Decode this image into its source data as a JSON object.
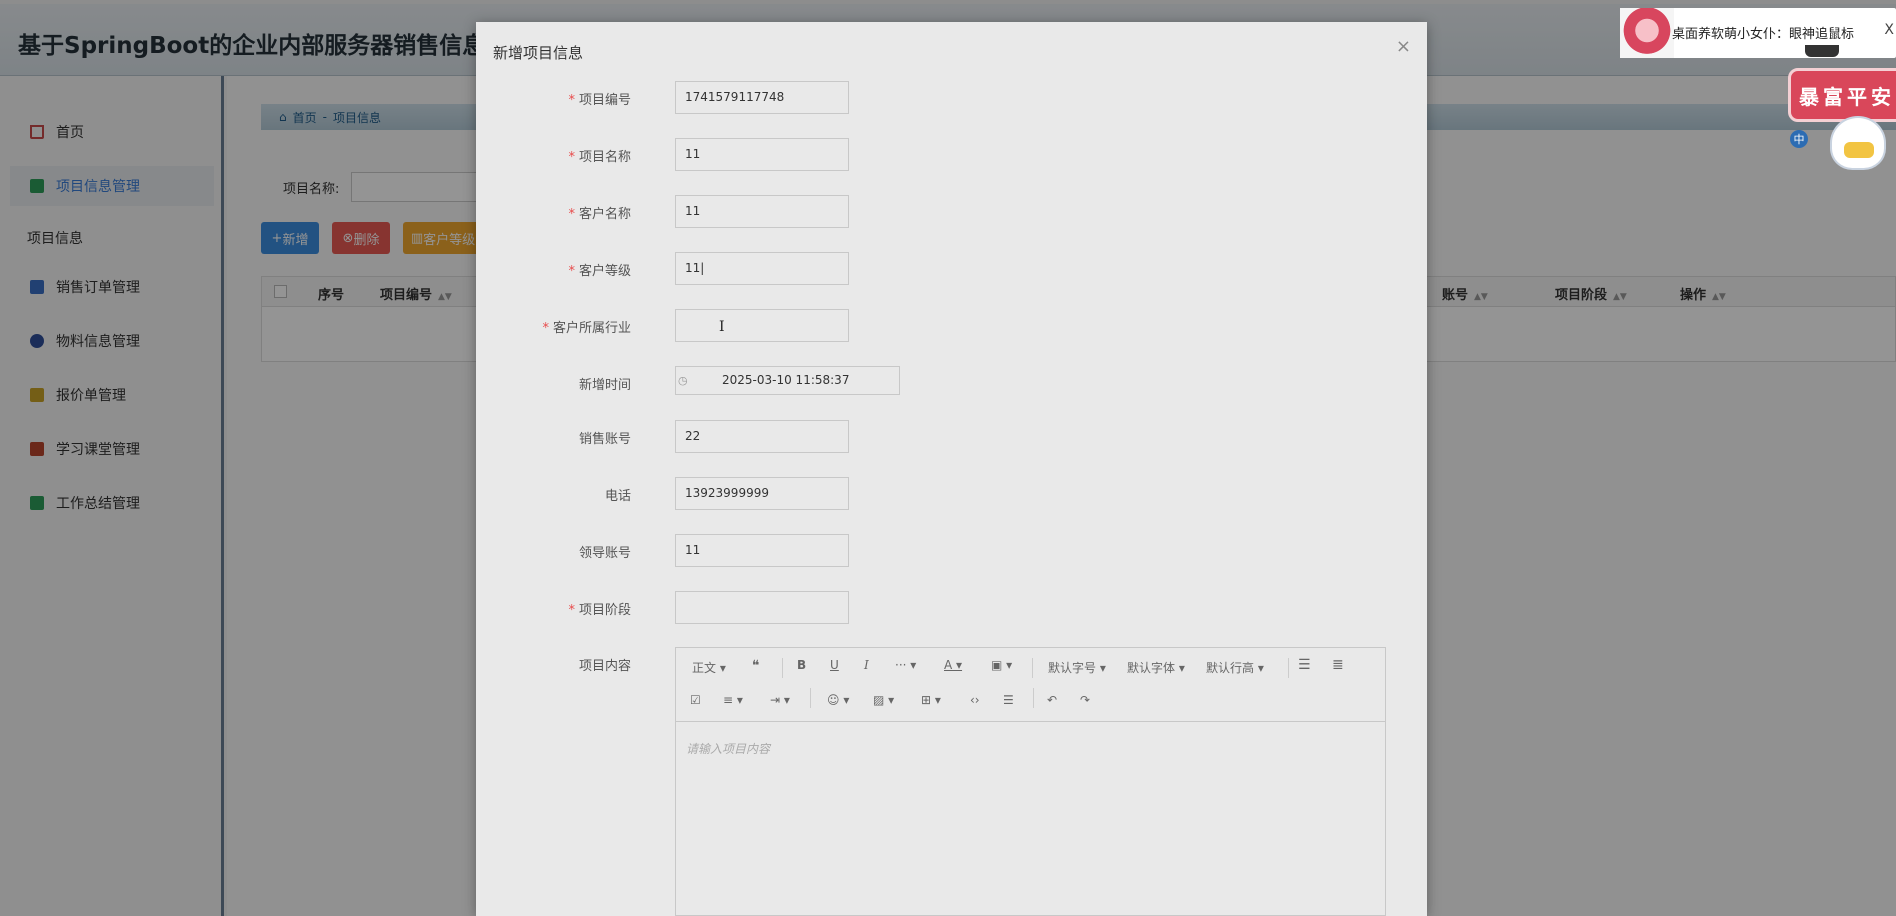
{
  "app": {
    "title": "基于SpringBoot的企业内部服务器销售信息管理"
  },
  "sidebar": {
    "items": [
      {
        "label": "首页",
        "icon": "home-icon",
        "color": "#c94a4a"
      },
      {
        "label": "项目信息管理",
        "icon": "layers-icon",
        "color": "#2e9d5a"
      },
      {
        "label": "销售订单管理",
        "icon": "list-icon",
        "color": "#3a6fc4"
      },
      {
        "label": "物料信息管理",
        "icon": "circle-icon",
        "color": "#2f4f9a"
      },
      {
        "label": "报价单管理",
        "icon": "pentagon-icon",
        "color": "#c9a227"
      },
      {
        "label": "学习课堂管理",
        "icon": "book-icon",
        "color": "#b8452e"
      },
      {
        "label": "工作总结管理",
        "icon": "table-icon",
        "color": "#2e9d5a"
      }
    ],
    "group_label": "项目信息"
  },
  "breadcrumb": {
    "home": "首页",
    "sep": "-",
    "current": "项目信息"
  },
  "filter": {
    "label": "项目名称:"
  },
  "buttons": {
    "add": "新增",
    "delete": "删除",
    "level": "客户等级"
  },
  "table": {
    "headers": [
      "序号",
      "项目编号",
      "账号",
      "项目阶段",
      "操作"
    ]
  },
  "modal": {
    "title": "新增项目信息",
    "close": "×",
    "fields": [
      {
        "label": "项目编号",
        "required": true,
        "value": "1741579117748"
      },
      {
        "label": "项目名称",
        "required": true,
        "value": "11"
      },
      {
        "label": "客户名称",
        "required": true,
        "value": "11"
      },
      {
        "label": "客户等级",
        "required": true,
        "value": "11|"
      },
      {
        "label": "客户所属行业",
        "required": true,
        "value": ""
      },
      {
        "label": "新增时间",
        "required": false,
        "value": "2025-03-10 11:58:37"
      },
      {
        "label": "销售账号",
        "required": false,
        "value": "22"
      },
      {
        "label": "电话",
        "required": false,
        "value": "13923999999"
      },
      {
        "label": "领导账号",
        "required": false,
        "value": "11"
      },
      {
        "label": "项目阶段",
        "required": true,
        "value": ""
      }
    ],
    "editor": {
      "label": "项目内容",
      "placeholder": "请输入项目内容",
      "toolbar": {
        "paragraph": "正文",
        "font_size": "默认字号",
        "font_family": "默认字体",
        "line_height": "默认行高"
      }
    }
  },
  "desktop_pet": {
    "text": "桌面养软萌小女仆：眼神追鼠标",
    "close": "X",
    "sticker_text": "暴富平安",
    "sticker_badge": "中"
  }
}
